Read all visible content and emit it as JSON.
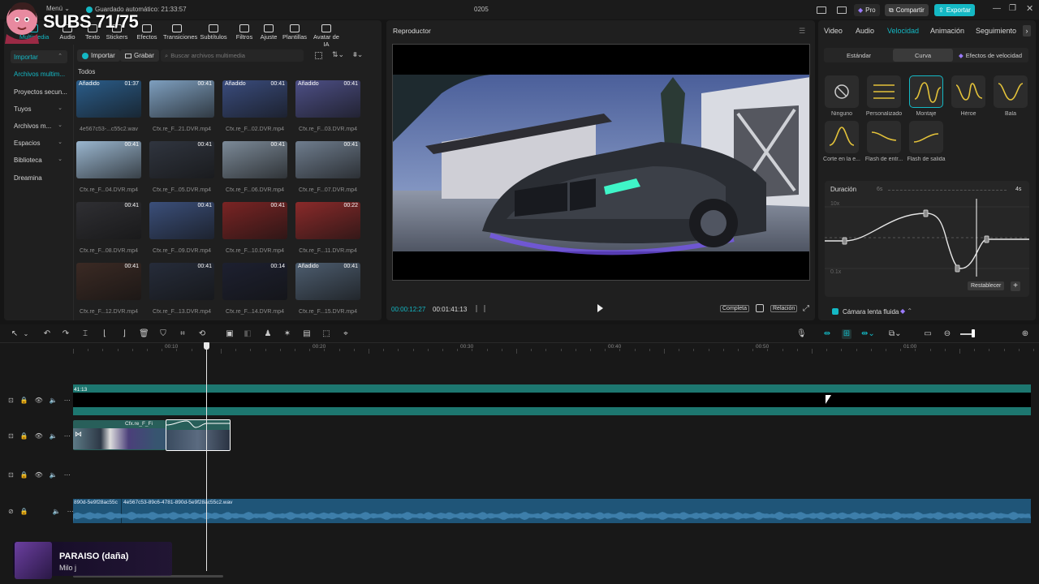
{
  "app": {
    "menu_label": "Menú",
    "autosave": "Guardado automático: 21:33:57",
    "project_name": "0205",
    "pro_label": "Pro",
    "share_label": "Compartir",
    "export_label": "Exportar"
  },
  "overlay": {
    "subs_text": "SUBS 71/75"
  },
  "media_toolbar": [
    {
      "label": "Multimedia",
      "icon": "media-icon"
    },
    {
      "label": "Audio",
      "icon": "audio-icon"
    },
    {
      "label": "Texto",
      "icon": "text-icon"
    },
    {
      "label": "Stickers",
      "icon": "sticker-icon"
    },
    {
      "label": "Efectos",
      "icon": "effects-icon"
    },
    {
      "label": "Transiciones",
      "icon": "transitions-icon"
    },
    {
      "label": "Subtítulos",
      "icon": "subtitles-icon"
    },
    {
      "label": "Filtros",
      "icon": "filters-icon"
    },
    {
      "label": "Ajuste",
      "icon": "adjust-icon"
    },
    {
      "label": "Plantillas",
      "icon": "templates-icon"
    },
    {
      "label": "Avatar de IA",
      "icon": "ai-avatar-icon"
    }
  ],
  "media_sidebar": [
    {
      "label": "Importar",
      "chev": true
    },
    {
      "label": "Archivos multim...",
      "chev": false
    },
    {
      "label": "Proyectos secun...",
      "chev": false
    },
    {
      "label": "Tuyos",
      "chev": true
    },
    {
      "label": "Archivos m...",
      "chev": true
    },
    {
      "label": "Espacios",
      "chev": true
    },
    {
      "label": "Biblioteca",
      "chev": true
    },
    {
      "label": "Dreamina",
      "chev": false
    }
  ],
  "media_actions": {
    "import_label": "Importar",
    "record_label": "Grabar",
    "search_placeholder": "Buscar archivos multimedia",
    "section_label": "Todos"
  },
  "media_items": [
    {
      "name": "4e567c53-...c55c2.wav",
      "duration": "01:37",
      "tag": "Añadido",
      "color": "#2b5d8a"
    },
    {
      "name": "Cfx.re_F...21.DVR.mp4",
      "duration": "00:41",
      "tag": "",
      "color": "#7e9fbf"
    },
    {
      "name": "Cfx.re_F...02.DVR.mp4",
      "duration": "00:41",
      "tag": "Añadido",
      "color": "#3a4c7d"
    },
    {
      "name": "Cfx.re_F...03.DVR.mp4",
      "duration": "00:41",
      "tag": "Añadido",
      "color": "#4d4f86"
    },
    {
      "name": "Cfx.re_F...04.DVR.mp4",
      "duration": "00:41",
      "tag": "",
      "color": "#9ab6cf"
    },
    {
      "name": "Cfx.re_F...05.DVR.mp4",
      "duration": "00:41",
      "tag": "",
      "color": "#30353f"
    },
    {
      "name": "Cfx.re_F...06.DVR.mp4",
      "duration": "00:41",
      "tag": "",
      "color": "#7c8a98"
    },
    {
      "name": "Cfx.re_F...07.DVR.mp4",
      "duration": "00:41",
      "tag": "",
      "color": "#6f7d8e"
    },
    {
      "name": "Cfx.re_F...08.DVR.mp4",
      "duration": "00:41",
      "tag": "",
      "color": "#2f2f33"
    },
    {
      "name": "Cfx.re_F...09.DVR.mp4",
      "duration": "00:41",
      "tag": "",
      "color": "#3b4f7a"
    },
    {
      "name": "Cfx.re_F...10.DVR.mp4",
      "duration": "00:41",
      "tag": "",
      "color": "#7a2424"
    },
    {
      "name": "Cfx.re_F...11.DVR.mp4",
      "duration": "00:22",
      "tag": "",
      "color": "#8a2a2a"
    },
    {
      "name": "Cfx.re_F...12.DVR.mp4",
      "duration": "00:41",
      "tag": "",
      "color": "#3b2a24"
    },
    {
      "name": "Cfx.re_F...13.DVR.mp4",
      "duration": "00:41",
      "tag": "",
      "color": "#262c3a"
    },
    {
      "name": "Cfx.re_F...14.DVR.mp4",
      "duration": "00:14",
      "tag": "",
      "color": "#1d2030"
    },
    {
      "name": "Cfx.re_F...15.DVR.mp4",
      "duration": "00:41",
      "tag": "Añadido",
      "color": "#4d5d6f"
    }
  ],
  "player": {
    "title": "Reproductor",
    "current_time": "00:00:12:27",
    "total_time": "00:01:41:13",
    "full_label": "Completa",
    "ratio_label": "Relación"
  },
  "props": {
    "tabs": [
      "Video",
      "Audio",
      "Velocidad",
      "Animación",
      "Seguimiento"
    ],
    "active_tab": "Velocidad",
    "subtabs": [
      "Estándar",
      "Curva",
      "Efectos de velocidad"
    ],
    "active_subtab": "Curva",
    "presets": [
      "Ninguno",
      "Personalizado",
      "Montaje",
      "Héroe",
      "Bala",
      "Corte en la e...",
      "Flash de entr...",
      "Flash de salida"
    ],
    "selected_preset": "Montaje",
    "duration_label": "Duración",
    "duration_from": "6s",
    "duration_to": "4s",
    "curve_top": "10x",
    "curve_bottom": "0.1x",
    "reset_label": "Restablecer",
    "smooth_label": "Cámara lenta fluida",
    "accent": "#14b8c4"
  },
  "timeline": {
    "ruler": [
      "00:10",
      "00:20",
      "00:30",
      "00:40",
      "00:50",
      "01:00"
    ],
    "track1_label": "41:13",
    "clip_label": "Cfx.re_F_Fi",
    "audio_label_a": "890d-5e9f28ac55c",
    "audio_label_b": "4e567c53-89c6-4781-890d-5e9f28ac55c2.wav"
  },
  "now_playing": {
    "title": "PARAISO (daña)",
    "artist": "Milo j"
  }
}
